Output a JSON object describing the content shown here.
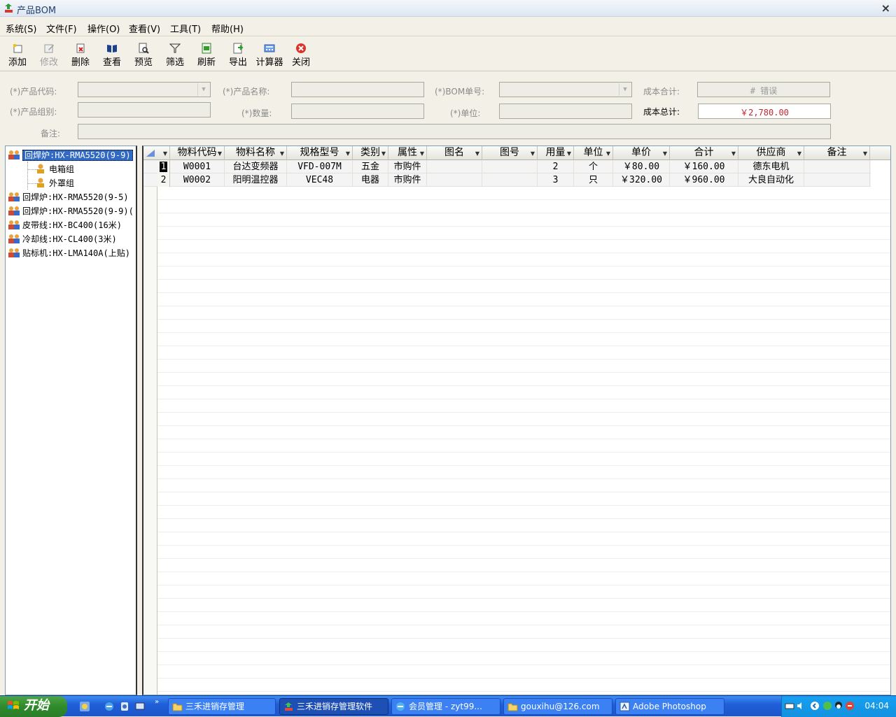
{
  "window": {
    "title": "产品BOM",
    "close_glyph": "×"
  },
  "menu": [
    "系统(S)",
    "文件(F)",
    "操作(O)",
    "查看(V)",
    "工具(T)",
    "帮助(H)"
  ],
  "toolbar": [
    {
      "label": "添加",
      "icon": "add-icon",
      "enabled": true
    },
    {
      "label": "修改",
      "icon": "edit-icon",
      "enabled": false
    },
    {
      "label": "删除",
      "icon": "delete-icon",
      "enabled": true
    },
    {
      "label": "查看",
      "icon": "view-icon",
      "enabled": true
    },
    {
      "label": "预览",
      "icon": "preview-icon",
      "enabled": true
    },
    {
      "label": "筛选",
      "icon": "filter-icon",
      "enabled": true
    },
    {
      "label": "刷新",
      "icon": "refresh-icon",
      "enabled": true
    },
    {
      "label": "导出",
      "icon": "export-icon",
      "enabled": true
    },
    {
      "label": "计算器",
      "icon": "calculator-icon",
      "enabled": true
    },
    {
      "label": "关闭",
      "icon": "close-icon",
      "enabled": true
    }
  ],
  "form": {
    "product_code_label": "(*)产品代码:",
    "product_code_value": "",
    "product_name_label": "(*)产品名称:",
    "product_name_value": "",
    "bom_no_label": "(*)BOM单号:",
    "bom_no_value": "",
    "cost_sum_label": "成本合计:",
    "cost_sum_value": "# 错误",
    "product_group_label": "(*)产品组别:",
    "product_group_value": "",
    "quantity_label": "(*)数量:",
    "quantity_value": "",
    "unit_label": "(*)单位:",
    "unit_value": "",
    "cost_total_label": "成本总计:",
    "cost_total_value": "￥2,780.00",
    "remarks_label": "备注:",
    "remarks_value": ""
  },
  "tree": {
    "nodes": [
      {
        "label": "回焊炉:HX-RMA5520(9-9)",
        "level": 0,
        "selected": true,
        "icon": "group-icon"
      },
      {
        "label": "电箱组",
        "level": 1,
        "selected": false,
        "icon": "user-icon"
      },
      {
        "label": "外罩组",
        "level": 1,
        "selected": false,
        "icon": "user-icon"
      },
      {
        "label": "回焊炉:HX-RMA5520(9-5)",
        "level": 0,
        "selected": false,
        "icon": "group-icon"
      },
      {
        "label": "回焊炉:HX-RMA5520(9-9)(",
        "level": 0,
        "selected": false,
        "icon": "group-icon"
      },
      {
        "label": "皮带线:HX-BC400(16米)",
        "level": 0,
        "selected": false,
        "icon": "group-icon"
      },
      {
        "label": "冷却线:HX-CL400(3米)",
        "level": 0,
        "selected": false,
        "icon": "group-icon"
      },
      {
        "label": "贴标机:HX-LMA140A(上贴)",
        "level": 0,
        "selected": false,
        "icon": "group-icon"
      }
    ]
  },
  "grid": {
    "columns": [
      "物料代码",
      "物料名称",
      "规格型号",
      "类别",
      "属性",
      "图名",
      "图号",
      "用量",
      "单位",
      "单价",
      "合计",
      "供应商",
      "备注"
    ],
    "rows": [
      {
        "no": "1",
        "current": true,
        "cells": [
          "W0001",
          "台达变频器",
          "VFD-007M",
          "五金",
          "市购件",
          "",
          "",
          "2",
          "个",
          "￥80.00",
          "￥160.00",
          "德东电机",
          ""
        ]
      },
      {
        "no": "2",
        "current": false,
        "cells": [
          "W0002",
          "阳明温控器",
          "VEC48",
          "电器",
          "市购件",
          "",
          "",
          "3",
          "只",
          "￥320.00",
          "￥960.00",
          "大良自动化",
          ""
        ]
      }
    ]
  },
  "taskbar": {
    "start_label": "开始",
    "tasks": [
      {
        "label": "三禾进销存管理",
        "icon": "folder-icon",
        "active": false
      },
      {
        "label": "三禾进销存管理软件",
        "icon": "app-icon",
        "active": true
      },
      {
        "label": "会员管理 - zyt99...",
        "icon": "ie-icon",
        "active": false
      },
      {
        "label": "gouxihu@126.com",
        "icon": "folder-icon",
        "active": false
      },
      {
        "label": "Adobe Photoshop",
        "icon": "photoshop-icon",
        "active": false
      }
    ],
    "clock": "04:04"
  }
}
